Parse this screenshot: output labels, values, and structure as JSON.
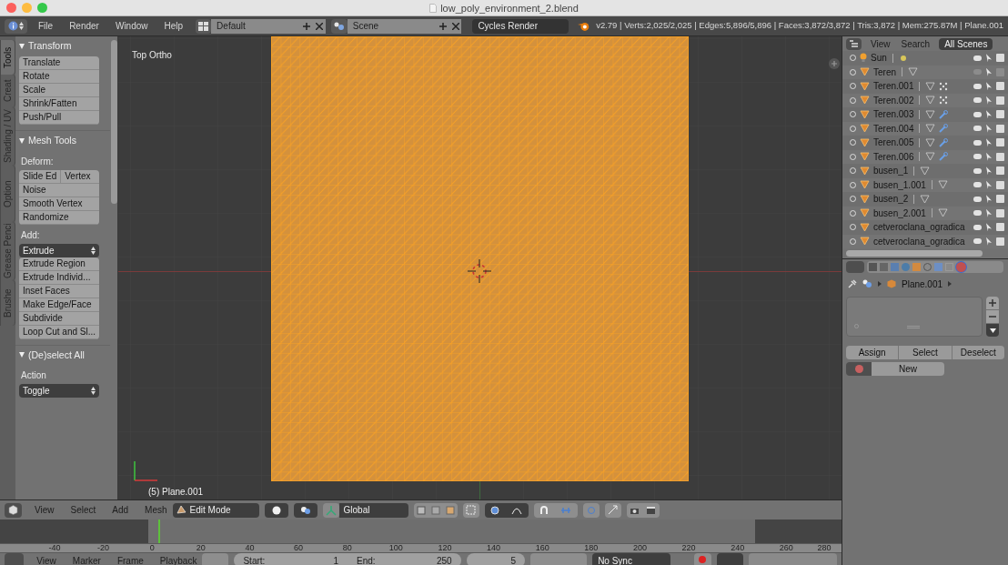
{
  "window": {
    "title": "low_poly_environment_2.blend"
  },
  "info_header": {
    "menus": [
      "File",
      "Render",
      "Window",
      "Help"
    ],
    "layout": "Default",
    "scene": "Scene",
    "engine": "Cycles Render",
    "stats": "v2.79 | Verts:2,025/2,025 | Edges:5,896/5,896 | Faces:3,872/3,872 | Tris:3,872 | Mem:275.87M | Plane.001"
  },
  "tool_tabs": [
    {
      "label": "Tools",
      "selected": true
    },
    {
      "label": "Creat",
      "selected": false
    },
    {
      "label": "Shading / UV",
      "selected": false
    },
    {
      "label": "Option",
      "selected": false
    },
    {
      "label": "Grease Penci",
      "selected": false
    },
    {
      "label": "Brushe",
      "selected": false
    }
  ],
  "tool_panels": [
    {
      "title": "Transform",
      "expanded": true,
      "items": [
        {
          "kind": "button",
          "label": "Translate"
        },
        {
          "kind": "button",
          "label": "Rotate"
        },
        {
          "kind": "button",
          "label": "Scale"
        },
        {
          "kind": "button",
          "label": "Shrink/Fatten"
        },
        {
          "kind": "button",
          "label": "Push/Pull"
        }
      ]
    },
    {
      "title": "Mesh Tools",
      "expanded": true,
      "items": [
        {
          "kind": "heading",
          "label": "Deform:"
        },
        {
          "kind": "pair",
          "labels": [
            "Slide Ed",
            "Vertex"
          ]
        },
        {
          "kind": "button",
          "label": "Noise"
        },
        {
          "kind": "button",
          "label": "Smooth Vertex"
        },
        {
          "kind": "button",
          "label": "Randomize"
        },
        {
          "kind": "heading",
          "label": "Add:"
        },
        {
          "kind": "dropdown",
          "label": "Extrude"
        },
        {
          "kind": "button",
          "label": "Extrude Region"
        },
        {
          "kind": "button",
          "label": "Extrude Individ..."
        },
        {
          "kind": "button",
          "label": "Inset Faces"
        },
        {
          "kind": "button",
          "label": "Make Edge/Face"
        },
        {
          "kind": "button",
          "label": "Subdivide"
        },
        {
          "kind": "button",
          "label": "Loop Cut and Sl..."
        }
      ]
    },
    {
      "title": "(De)select All",
      "expanded": true,
      "items": [
        {
          "kind": "heading",
          "label": "Action"
        },
        {
          "kind": "dropdown",
          "label": "Toggle"
        }
      ]
    }
  ],
  "viewport": {
    "view_name": "Top Ortho",
    "object_label": "(5) Plane.001"
  },
  "viewport_header": {
    "menus": [
      "View",
      "Select",
      "Add",
      "Mesh"
    ],
    "mode": "Edit Mode",
    "orientation": "Global"
  },
  "timeline": {
    "ticks": [
      "-40",
      "-20",
      "0",
      "20",
      "40",
      "60",
      "80",
      "100",
      "120",
      "140",
      "160",
      "180",
      "200",
      "220",
      "240",
      "260",
      "280"
    ]
  },
  "timeline_header": {
    "menus": [
      "View",
      "Marker",
      "Frame",
      "Playback"
    ],
    "start_label": "Start:",
    "start": "1",
    "end_label": "End:",
    "end": "250",
    "current": "5",
    "sync": "No Sync"
  },
  "outliner": {
    "menus": [
      "View",
      "Search"
    ],
    "filter": "All Scenes",
    "rows": [
      {
        "name": "Sun",
        "kind": "lamp",
        "show_data": true,
        "particles": false,
        "modifier": false,
        "visible": true
      },
      {
        "name": "Teren",
        "kind": "mesh",
        "show_data": true,
        "particles": false,
        "modifier": false,
        "visible": false
      },
      {
        "name": "Teren.001",
        "kind": "mesh",
        "show_data": true,
        "particles": true,
        "modifier": false,
        "visible": true
      },
      {
        "name": "Teren.002",
        "kind": "mesh",
        "show_data": true,
        "particles": true,
        "modifier": false,
        "visible": true
      },
      {
        "name": "Teren.003",
        "kind": "mesh",
        "show_data": true,
        "particles": false,
        "modifier": true,
        "visible": true
      },
      {
        "name": "Teren.004",
        "kind": "mesh",
        "show_data": true,
        "particles": false,
        "modifier": true,
        "visible": true
      },
      {
        "name": "Teren.005",
        "kind": "mesh",
        "show_data": true,
        "particles": false,
        "modifier": true,
        "visible": true
      },
      {
        "name": "Teren.006",
        "kind": "mesh",
        "show_data": true,
        "particles": false,
        "modifier": true,
        "visible": true
      },
      {
        "name": "busen_1",
        "kind": "mesh",
        "show_data": true,
        "particles": false,
        "modifier": false,
        "visible": true
      },
      {
        "name": "busen_1.001",
        "kind": "mesh",
        "show_data": true,
        "particles": false,
        "modifier": false,
        "visible": true
      },
      {
        "name": "busen_2",
        "kind": "mesh",
        "show_data": true,
        "particles": false,
        "modifier": false,
        "visible": true
      },
      {
        "name": "busen_2.001",
        "kind": "mesh",
        "show_data": true,
        "particles": false,
        "modifier": false,
        "visible": true
      },
      {
        "name": "cetveroclana_ogradica",
        "kind": "mesh",
        "show_data": false,
        "particles": false,
        "modifier": false,
        "visible": true
      },
      {
        "name": "cetveroclana_ogradica",
        "kind": "mesh",
        "show_data": false,
        "particles": false,
        "modifier": false,
        "visible": true
      }
    ]
  },
  "properties": {
    "object": "Plane.001",
    "buttons": [
      "Assign",
      "Select",
      "Deselect"
    ],
    "new_button": "New"
  }
}
